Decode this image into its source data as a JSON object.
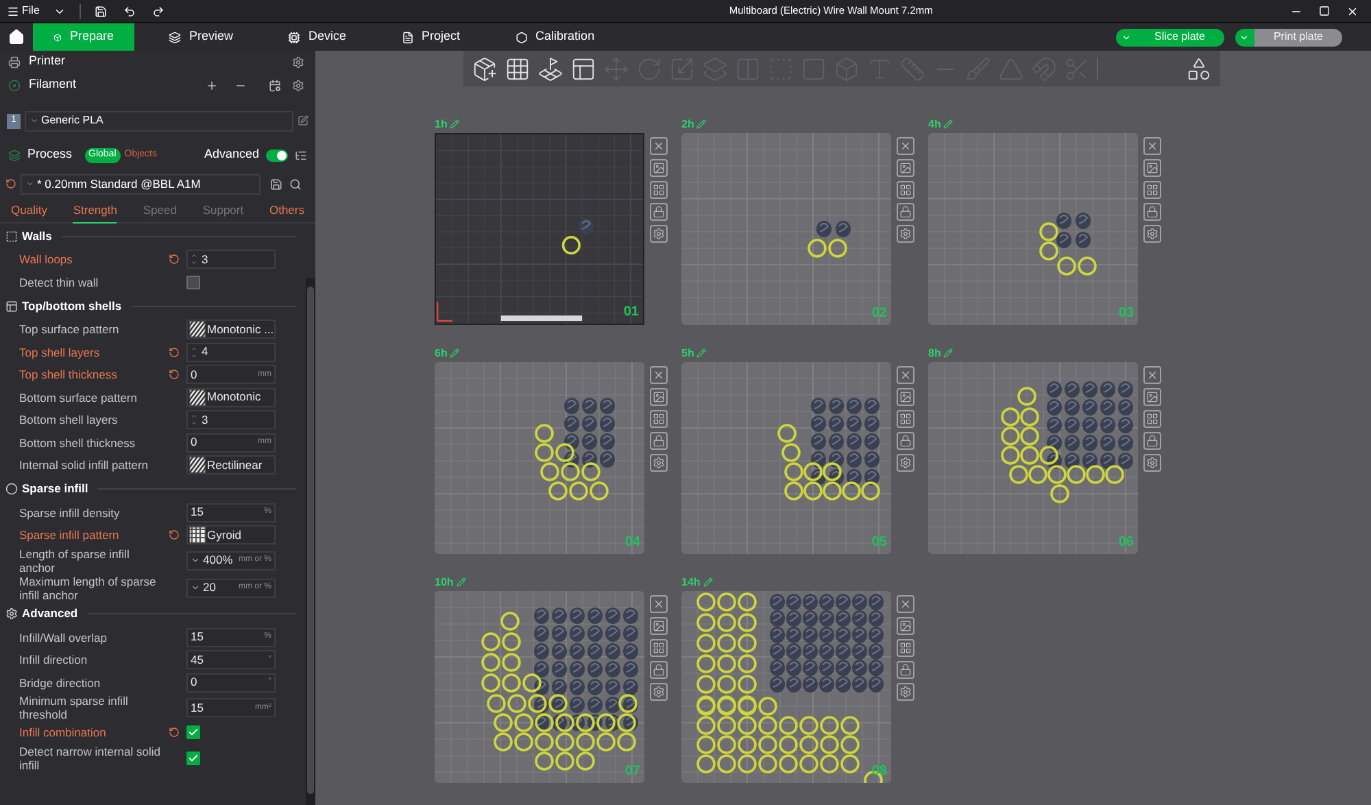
{
  "menu": {
    "file": "File"
  },
  "window_title": "Multiboard (Electric) Wire Wall Mount 7.2mm",
  "tabs": [
    {
      "label": "Prepare",
      "selected": true
    },
    {
      "label": "Preview",
      "selected": false
    },
    {
      "label": "Device",
      "selected": false
    },
    {
      "label": "Project",
      "selected": false
    },
    {
      "label": "Calibration",
      "selected": false
    }
  ],
  "actions": [
    {
      "label": "Slice plate",
      "kind": "primary"
    },
    {
      "label": "Print plate",
      "kind": "secondary"
    }
  ],
  "sidebar": {
    "printer": "Printer",
    "filament": "Filament",
    "filament_slot": "1",
    "filament_name": "Generic PLA",
    "process": "Process",
    "scope": [
      {
        "label": "Global",
        "selected": true
      },
      {
        "label": "Objects",
        "selected": false
      }
    ],
    "advanced": {
      "label": "Advanced",
      "on": true
    },
    "preset": "* 0.20mm Standard @BBL A1M",
    "setting_tabs": [
      {
        "label": "Quality",
        "modified": true,
        "selected": false
      },
      {
        "label": "Strength",
        "modified": true,
        "selected": true
      },
      {
        "label": "Speed",
        "modified": false,
        "selected": false
      },
      {
        "label": "Support",
        "modified": false,
        "selected": false
      },
      {
        "label": "Others",
        "modified": true,
        "selected": false
      }
    ],
    "sections": [
      {
        "title": "Walls",
        "rows": [
          {
            "label": "Wall loops",
            "modified": true,
            "kind": "integer",
            "value": "3"
          },
          {
            "label": "Detect thin wall",
            "modified": false,
            "kind": "check",
            "checked": false
          }
        ]
      },
      {
        "title": "Top/bottom shells",
        "rows": [
          {
            "label": "Top surface pattern",
            "modified": false,
            "kind": "pattern",
            "value": "Monotonic ..."
          },
          {
            "label": "Top shell layers",
            "modified": true,
            "kind": "integer",
            "value": "4"
          },
          {
            "label": "Top shell thickness",
            "modified": true,
            "kind": "number",
            "value": "0",
            "unit": "mm"
          },
          {
            "label": "Bottom surface pattern",
            "modified": false,
            "kind": "pattern",
            "value": "Monotonic"
          },
          {
            "label": "Bottom shell layers",
            "modified": false,
            "kind": "integer",
            "value": "3"
          },
          {
            "label": "Bottom shell thickness",
            "modified": false,
            "kind": "number",
            "value": "0",
            "unit": "mm"
          },
          {
            "label": "Internal solid infill pattern",
            "modified": false,
            "kind": "pattern",
            "value": "Rectilinear"
          }
        ]
      },
      {
        "title": "Sparse infill",
        "rows": [
          {
            "label": "Sparse infill density",
            "modified": false,
            "kind": "number",
            "value": "15",
            "unit": "%"
          },
          {
            "label": "Sparse infill pattern",
            "modified": true,
            "kind": "pattern",
            "value": "Gyroid"
          },
          {
            "label": "Length of sparse infill anchor",
            "modified": false,
            "kind": "dropdown",
            "value": "400%",
            "unit": "mm or %"
          },
          {
            "label": "Maximum length of sparse infill anchor",
            "modified": false,
            "kind": "dropdown",
            "value": "20",
            "unit": "mm or %"
          }
        ]
      },
      {
        "title": "Advanced",
        "rows": [
          {
            "label": "Infill/Wall overlap",
            "modified": false,
            "kind": "number",
            "value": "15",
            "unit": "%"
          },
          {
            "label": "Infill direction",
            "modified": false,
            "kind": "number",
            "value": "45",
            "unit": "°"
          },
          {
            "label": "Bridge direction",
            "modified": false,
            "kind": "number",
            "value": "0",
            "unit": "°"
          },
          {
            "label": "Minimum sparse infill threshold",
            "modified": false,
            "kind": "number",
            "value": "15",
            "unit": "mm²"
          },
          {
            "label": "Infill combination",
            "modified": true,
            "kind": "check",
            "checked": true
          },
          {
            "label": "Detect narrow internal solid infill",
            "modified": false,
            "kind": "check",
            "checked": true
          }
        ]
      }
    ]
  },
  "plates": [
    {
      "label": "1h",
      "number": "01",
      "selected": true
    },
    {
      "label": "2h",
      "number": "02",
      "selected": false
    },
    {
      "label": "4h",
      "number": "03",
      "selected": false
    },
    {
      "label": "6h",
      "number": "04",
      "selected": false
    },
    {
      "label": "5h",
      "number": "05",
      "selected": false
    },
    {
      "label": "8h",
      "number": "06",
      "selected": false
    },
    {
      "label": "10h",
      "number": "07",
      "selected": false
    },
    {
      "label": "14h",
      "number": "08",
      "selected": false
    }
  ]
}
